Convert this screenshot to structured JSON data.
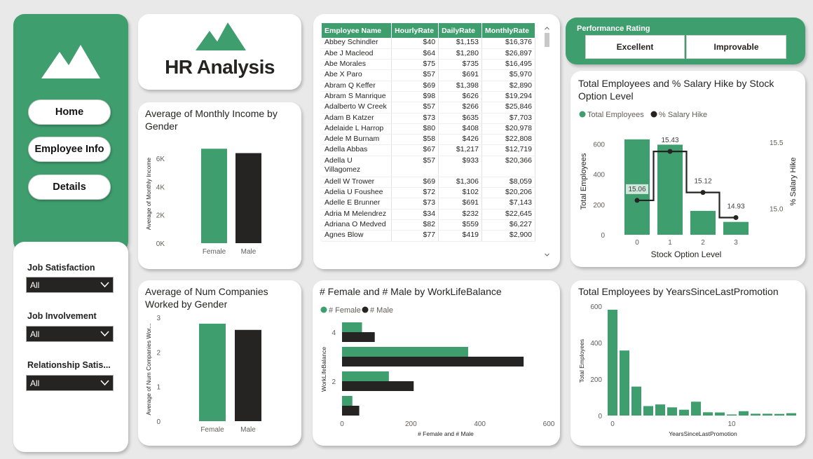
{
  "colors": {
    "accent": "#3f9e6d",
    "dark": "#252423",
    "background": "#e9e9e9"
  },
  "logo": {
    "title": "HR Analysis"
  },
  "nav": {
    "items": [
      {
        "label": "Home"
      },
      {
        "label": "Employee Info"
      },
      {
        "label": "Details"
      }
    ]
  },
  "filters": [
    {
      "label": "Job Satisfaction",
      "value": "All"
    },
    {
      "label": "Job Involvement",
      "value": "All"
    },
    {
      "label": "Relationship Satis...",
      "value": "All"
    }
  ],
  "employee_table": {
    "columns": [
      "Employee Name",
      "HourlyRate",
      "DailyRate",
      "MonthlyRate"
    ],
    "rows": [
      [
        "Abbey Schindler",
        "$40",
        "$1,153",
        "$16,376"
      ],
      [
        "Abe J Macleod",
        "$64",
        "$1,280",
        "$26,897"
      ],
      [
        "Abe Morales",
        "$75",
        "$735",
        "$16,495"
      ],
      [
        "Abe X Paro",
        "$57",
        "$691",
        "$5,970"
      ],
      [
        "Abram Q Keffer",
        "$69",
        "$1,398",
        "$2,890"
      ],
      [
        "Abram S Manrique",
        "$98",
        "$626",
        "$19,294"
      ],
      [
        "Adalberto W Creek",
        "$57",
        "$266",
        "$25,846"
      ],
      [
        "Adam B Katzer",
        "$73",
        "$635",
        "$7,703"
      ],
      [
        "Adelaide L Harrop",
        "$80",
        "$408",
        "$20,978"
      ],
      [
        "Adele M Burnam",
        "$58",
        "$426",
        "$22,808"
      ],
      [
        "Adella Abbas",
        "$67",
        "$1,217",
        "$12,719"
      ],
      [
        "Adella U Villagomez",
        "$57",
        "$933",
        "$20,366"
      ],
      [
        "Adell W Trower",
        "$69",
        "$1,306",
        "$8,059"
      ],
      [
        "Adelia U Foushee",
        "$72",
        "$102",
        "$20,206"
      ],
      [
        "Adelle E Brunner",
        "$73",
        "$691",
        "$7,143"
      ],
      [
        "Adria M Melendrez",
        "$34",
        "$232",
        "$22,645"
      ],
      [
        "Adriana O Medved",
        "$82",
        "$559",
        "$6,227"
      ],
      [
        "Agnes Blow",
        "$77",
        "$419",
        "$2,900"
      ]
    ]
  },
  "performance": {
    "title": "Performance Rating",
    "options": [
      "Excellent",
      "Improvable"
    ]
  },
  "charts": {
    "income": {
      "title": "Average of Monthly Income by Gender",
      "chart_data": {
        "type": "bar",
        "title": "Average of Monthly Income by Gender",
        "categories": [
          "Female",
          "Male"
        ],
        "values": [
          6690,
          6380
        ],
        "ylabel": "Average of Monthly Income",
        "ylim": [
          0,
          7000
        ],
        "yticks": [
          "0K",
          "2K",
          "4K",
          "6K"
        ]
      }
    },
    "companies": {
      "title": "Average of Num Companies Worked by Gender",
      "chart_data": {
        "type": "bar",
        "title": "Average of Num Companies Worked by Gender",
        "categories": [
          "Female",
          "Male"
        ],
        "values": [
          2.82,
          2.64
        ],
        "ylabel": "Average of Num Companies Wor...",
        "ylim": [
          0,
          3
        ],
        "yticks": [
          "0",
          "1",
          "2",
          "3"
        ]
      }
    },
    "stock": {
      "title": "Total Employees and % Salary Hike by Stock Option Level",
      "chart_data": {
        "type": "bar",
        "title": "Total Employees and % Salary Hike by Stock Option Level",
        "categories": [
          "0",
          "1",
          "2",
          "3"
        ],
        "series": [
          {
            "name": "Total Employees",
            "values": [
              631,
              596,
              158,
              85
            ]
          },
          {
            "name": "% Salary Hike",
            "values": [
              15.06,
              15.43,
              15.12,
              14.93
            ]
          }
        ],
        "data_labels": [
          "15.06",
          "15.43",
          "15.12",
          "14.93"
        ],
        "xlabel": "Stock Option Level",
        "ylabel": "Total Employees",
        "y2label": "% Salary Hike",
        "ylim": [
          0,
          700
        ],
        "y2lim": [
          14.8,
          15.6
        ],
        "yticks": [
          "0",
          "200",
          "400",
          "600"
        ],
        "y2ticks": [
          "15.0",
          "15.5"
        ]
      }
    },
    "wlb": {
      "title": "# Female and # Male by WorkLifeBalance",
      "chart_data": {
        "type": "bar",
        "title": "# Female and # Male by WorkLifeBalance",
        "categories": [
          "4",
          "3",
          "2",
          "1"
        ],
        "category_labels": [
          "4",
          "",
          "2",
          ""
        ],
        "series": [
          {
            "name": "# Female",
            "values": [
              58,
              366,
              136,
              30
            ]
          },
          {
            "name": "# Male",
            "values": [
              95,
              527,
              208,
              50
            ]
          }
        ],
        "xlabel": "# Female and # Male",
        "ylabel": "WorkLifeBalance",
        "xlim": [
          0,
          600
        ],
        "xticks": [
          "0",
          "200",
          "400",
          "600"
        ]
      }
    },
    "promotion": {
      "title": "Total Employees by YearsSinceLastPromotion",
      "chart_data": {
        "type": "bar",
        "title": "Total Employees by YearsSinceLastPromotion",
        "x": [
          0,
          1,
          2,
          3,
          4,
          5,
          6,
          7,
          8,
          9,
          10,
          11,
          12,
          13,
          14,
          15
        ],
        "values": [
          581,
          357,
          159,
          52,
          61,
          45,
          32,
          76,
          18,
          17,
          6,
          24,
          10,
          10,
          9,
          13
        ],
        "xlabel": "YearsSinceLastPromotion",
        "ylabel": "Total Employees",
        "ylim": [
          0,
          600
        ],
        "yticks": [
          "0",
          "200",
          "400",
          "600"
        ],
        "xticks": [
          "0",
          "10"
        ]
      }
    }
  }
}
